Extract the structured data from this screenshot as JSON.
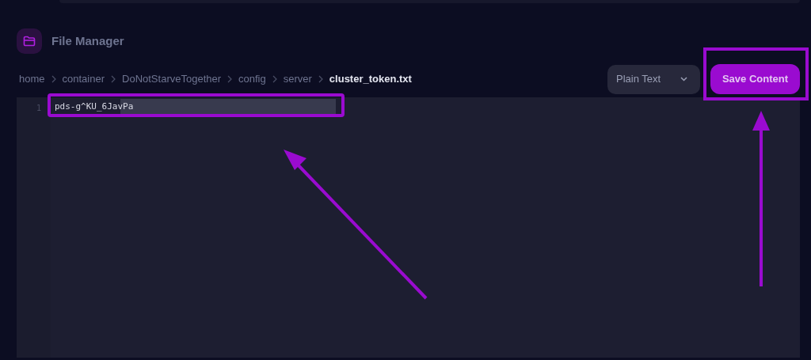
{
  "header": {
    "title": "File Manager"
  },
  "breadcrumb": [
    {
      "label": "home",
      "current": false
    },
    {
      "label": "container",
      "current": false
    },
    {
      "label": "DoNotStarveTogether",
      "current": false
    },
    {
      "label": "config",
      "current": false
    },
    {
      "label": "server",
      "current": false
    },
    {
      "label": "cluster_token.txt",
      "current": true
    }
  ],
  "language_select": {
    "value": "Plain Text"
  },
  "save_button": {
    "label": "Save Content"
  },
  "editor": {
    "lines": [
      {
        "number": "1",
        "text": "pds-g^KU_6JavPa",
        "selected": true
      }
    ]
  }
}
